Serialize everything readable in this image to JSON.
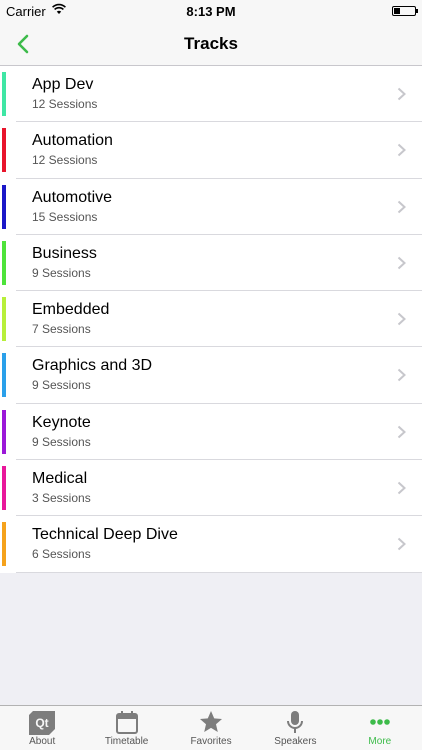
{
  "status_bar": {
    "carrier": "Carrier",
    "time": "8:13 PM"
  },
  "nav": {
    "title": "Tracks",
    "back_icon": "chevron-left-icon",
    "accent": "#3dbb4a"
  },
  "tracks": [
    {
      "name": "App Dev",
      "sessions": "12 Sessions",
      "color": "#3fe6a4"
    },
    {
      "name": "Automation",
      "sessions": "12 Sessions",
      "color": "#e8142b"
    },
    {
      "name": "Automotive",
      "sessions": "15 Sessions",
      "color": "#1a17c8"
    },
    {
      "name": "Business",
      "sessions": "9 Sessions",
      "color": "#4ee33a"
    },
    {
      "name": "Embedded",
      "sessions": "7 Sessions",
      "color": "#b7ef3a"
    },
    {
      "name": "Graphics and 3D",
      "sessions": "9 Sessions",
      "color": "#2aa0ea"
    },
    {
      "name": "Keynote",
      "sessions": "9 Sessions",
      "color": "#9b18d8"
    },
    {
      "name": "Medical",
      "sessions": "3 Sessions",
      "color": "#e8179a"
    },
    {
      "name": "Technical Deep Dive",
      "sessions": "6 Sessions",
      "color": "#f5a21c"
    }
  ],
  "tab_bar": {
    "tabs": [
      {
        "label": "About",
        "icon": "qt-logo-icon"
      },
      {
        "label": "Timetable",
        "icon": "calendar-icon"
      },
      {
        "label": "Favorites",
        "icon": "star-icon"
      },
      {
        "label": "Speakers",
        "icon": "microphone-icon"
      },
      {
        "label": "More",
        "icon": "more-dots-icon",
        "active": true
      }
    ]
  }
}
